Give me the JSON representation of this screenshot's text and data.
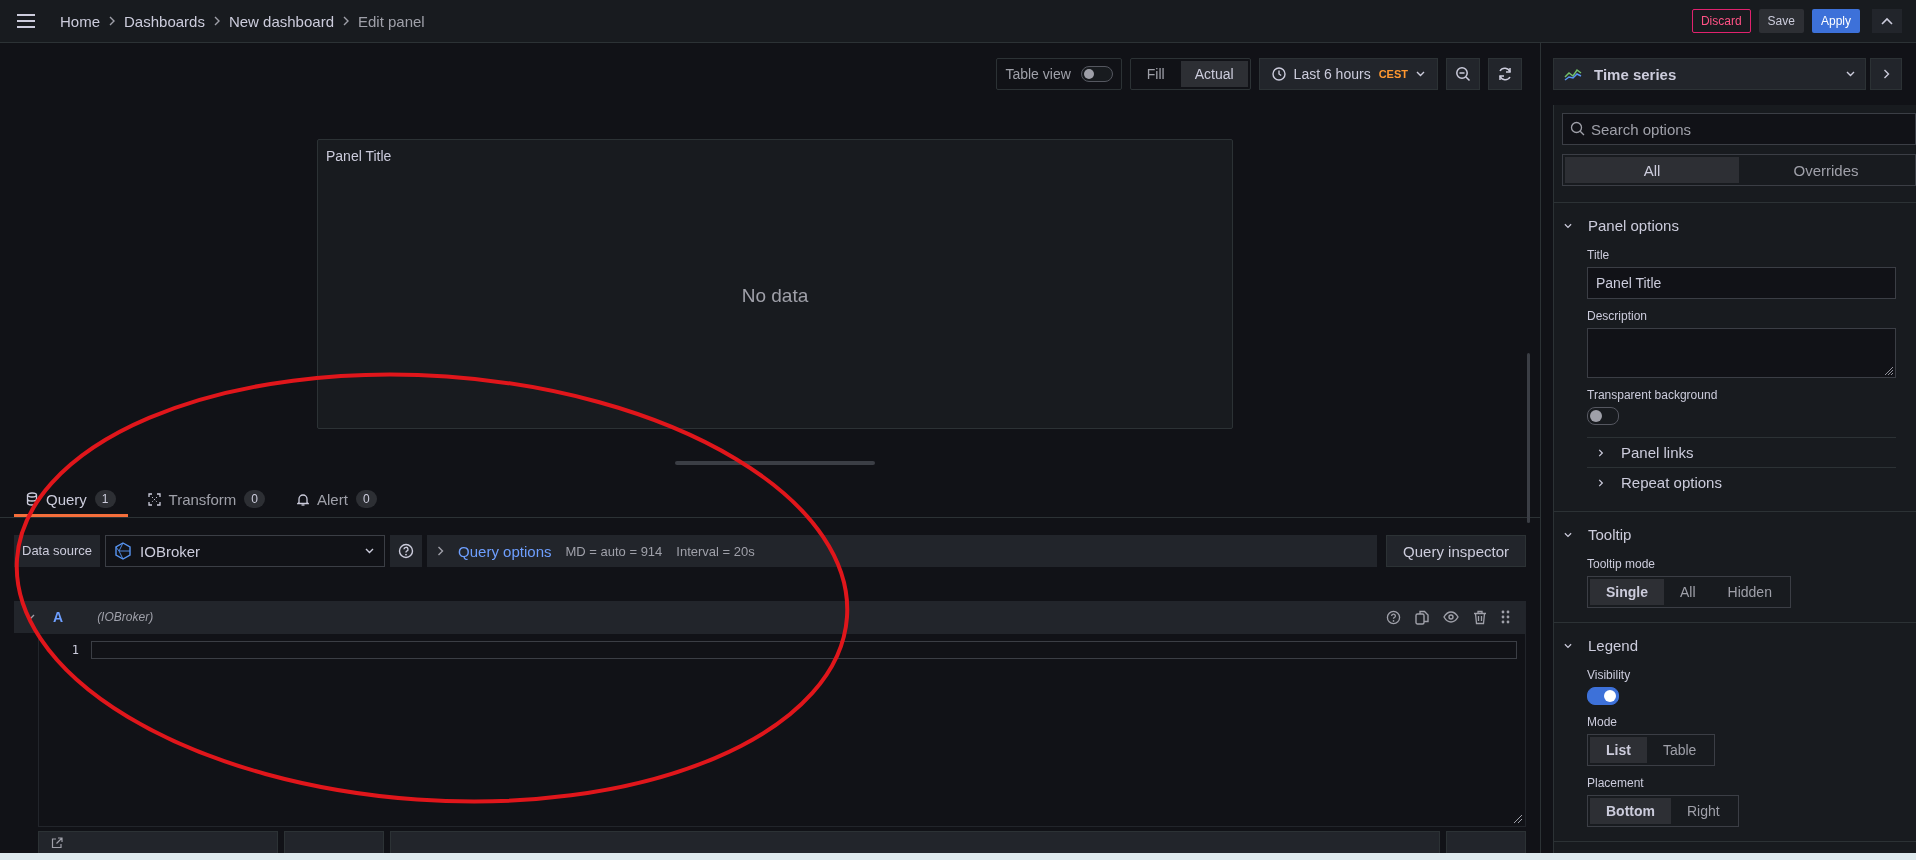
{
  "breadcrumbs": [
    {
      "label": "Home",
      "current": false
    },
    {
      "label": "Dashboards",
      "current": false
    },
    {
      "label": "New dashboard",
      "current": false
    },
    {
      "label": "Edit panel",
      "current": true
    }
  ],
  "header_buttons": [
    {
      "label": "Discard",
      "kind": "danger"
    },
    {
      "label": "Save",
      "kind": "secondary"
    },
    {
      "label": "Apply",
      "kind": "primary"
    }
  ],
  "toolbar": {
    "table_view": {
      "label": "Table view",
      "on": false
    },
    "size_modes": [
      {
        "label": "Fill",
        "selected": false
      },
      {
        "label": "Actual",
        "selected": true
      }
    ],
    "time_range": {
      "label": "Last 6 hours",
      "timezone": "CEST"
    }
  },
  "visualization": {
    "label": "Time series"
  },
  "panel": {
    "title": "Panel Title",
    "message": "No data"
  },
  "tabs": [
    {
      "label": "Query",
      "count": "1",
      "selected": true
    },
    {
      "label": "Transform",
      "count": "0",
      "selected": false
    },
    {
      "label": "Alert",
      "count": "0",
      "selected": false
    }
  ],
  "query": {
    "data_source_label": "Data source",
    "data_source": "IOBroker",
    "options_label": "Query options",
    "md": "MD = auto = 914",
    "interval": "Interval = 20s",
    "inspector": "Query inspector",
    "queries": [
      {
        "ref": "A",
        "source": "(IOBroker)",
        "expanded": true,
        "lines": [
          "1"
        ]
      }
    ]
  },
  "options": {
    "search_placeholder": "Search options",
    "tabs": [
      {
        "label": "All",
        "selected": true
      },
      {
        "label": "Overrides",
        "selected": false
      }
    ],
    "sections": [
      {
        "title": "Panel options",
        "expanded": true,
        "items": [
          {
            "kind": "text",
            "label": "Title",
            "value": "Panel Title"
          },
          {
            "kind": "textarea",
            "label": "Description"
          },
          {
            "kind": "switch",
            "label": "Transparent background",
            "on": false
          },
          {
            "kind": "group",
            "label": "Panel links",
            "expanded": false
          },
          {
            "kind": "group",
            "label": "Repeat options",
            "expanded": false
          }
        ]
      },
      {
        "title": "Tooltip",
        "expanded": true,
        "items": [
          {
            "kind": "radio",
            "label": "Tooltip mode",
            "options": [
              {
                "label": "Single",
                "selected": true
              },
              {
                "label": "All",
                "selected": false
              },
              {
                "label": "Hidden",
                "selected": false
              }
            ]
          }
        ]
      },
      {
        "title": "Legend",
        "expanded": true,
        "items": [
          {
            "kind": "switch",
            "label": "Visibility",
            "on": true
          },
          {
            "kind": "radio",
            "label": "Mode",
            "options": [
              {
                "label": "List",
                "selected": true
              },
              {
                "label": "Table",
                "selected": false
              }
            ]
          },
          {
            "kind": "radio",
            "label": "Placement",
            "options": [
              {
                "label": "Bottom",
                "selected": true
              },
              {
                "label": "Right",
                "selected": false
              }
            ]
          }
        ]
      }
    ]
  }
}
